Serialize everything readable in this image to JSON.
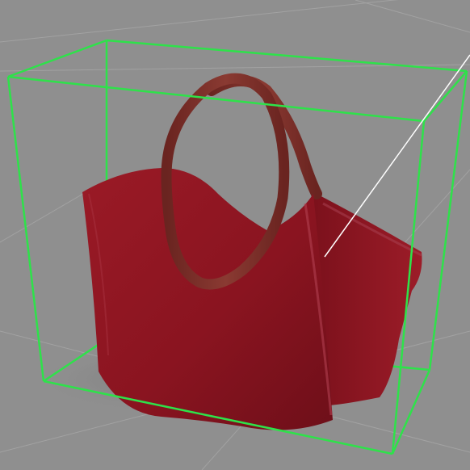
{
  "viewport": {
    "label": "",
    "background_color": "#8f8f8f",
    "grid_color": "#a3a3a3",
    "selection_box_color": "#2ee24a",
    "pointer_line_color": "#ffffff"
  },
  "object": {
    "name": "",
    "material_color": "#8a1420",
    "handle_color": "#7a2a26"
  }
}
